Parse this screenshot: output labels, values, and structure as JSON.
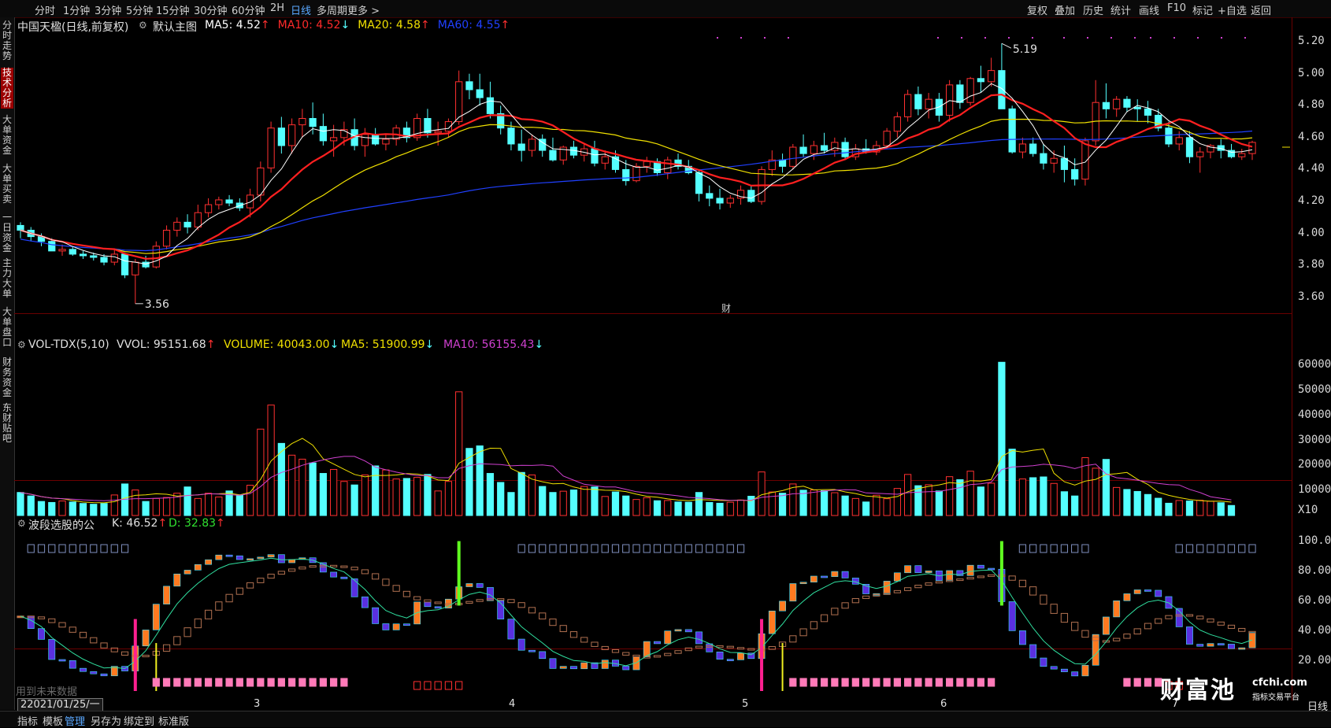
{
  "toolbar": {
    "left_tab": "分时走势",
    "periods": [
      "分时",
      "1分钟",
      "3分钟",
      "5分钟",
      "15分钟",
      "30分钟",
      "60分钟",
      "2H",
      "日线",
      "多周期",
      "更多 >"
    ],
    "active_period": "日线",
    "right_tools": [
      "复权",
      "叠加",
      "历史",
      "统计",
      "画线",
      "F10",
      "标记",
      "+自选",
      "返回"
    ]
  },
  "sidebar": {
    "items": [
      "分时走势",
      "技术分析",
      "大单资金",
      "大单买卖",
      "一日资金",
      "主力大单",
      "大单盘口",
      "财务资金",
      "东财贴吧"
    ],
    "active": "技术分析"
  },
  "main_pane": {
    "stock_name": "中国天楹(日线,前复权)",
    "template_label": "默认主图",
    "ma": [
      {
        "label": "MA5: 4.52",
        "arrow": "↑",
        "color": "#ffffff"
      },
      {
        "label": "MA10: 4.52",
        "arrow": "↓",
        "color": "#ff2a2a"
      },
      {
        "label": "MA20: 4.58",
        "arrow": "↑",
        "color": "#f0e000"
      },
      {
        "label": "MA60: 4.55",
        "arrow": "↑",
        "color": "#2040ff"
      }
    ],
    "high_label": "5.19",
    "low_label": "3.56",
    "event_marker": "财",
    "price_ticks": [
      "5.20",
      "5.00",
      "4.80",
      "4.60",
      "4.40",
      "4.20",
      "4.00",
      "3.80",
      "3.60"
    ],
    "ylim": [
      3.5,
      5.24
    ]
  },
  "volume_pane": {
    "name": "VOL-TDX(5,10)",
    "vvol": "VVOL: 95151.68",
    "vvol_arrow": "↑",
    "volume": "VOLUME: 40043.00",
    "volume_arrow": "↓",
    "ma5": "MA5: 51900.99",
    "ma5_arrow": "↓",
    "ma10": "MA10: 56155.43",
    "ma10_arrow": "↓",
    "ticks": [
      "60000",
      "50000",
      "40000",
      "30000",
      "20000",
      "10000"
    ],
    "unit": "X10"
  },
  "indicator_pane": {
    "name": "波段选股的公",
    "k": "K: 46.52",
    "k_arrow": "↑",
    "d": "D: 32.83",
    "d_arrow": "↑",
    "ticks": [
      "100.0",
      "80.00",
      "60.00",
      "40.00",
      "20.00"
    ],
    "note": "用到未来数据"
  },
  "xaxis": {
    "cursor_date": "2021/01/25/一",
    "cursor_prefix": "2",
    "months": [
      "3",
      "4",
      "5",
      "6",
      "7"
    ],
    "right_label": "日线"
  },
  "watermark": {
    "brand": "财富池",
    "site": "cfchi.com",
    "slogan": "指标交易平台"
  },
  "bottombar": {
    "items": [
      "指标",
      "模板",
      "管理",
      "另存为",
      "绑定到",
      "标准版"
    ],
    "active": "管理"
  },
  "colors": {
    "up": "#ff3030",
    "down": "#54ffff",
    "ma5": "#ffffff",
    "ma10": "#ff2020",
    "ma20": "#f0e000",
    "ma60": "#2040ff",
    "vol_ma5": "#f0e000",
    "vol_ma10": "#d040d0"
  },
  "chart_data": {
    "type": "candlestick",
    "note_units": "price in CNY, volume in lots/10",
    "ohlc": [
      [
        4.05,
        4.07,
        3.97,
        4.02
      ],
      [
        4.02,
        4.04,
        3.95,
        3.98
      ],
      [
        3.98,
        4.0,
        3.92,
        3.95
      ],
      [
        3.95,
        3.97,
        3.9,
        3.89
      ],
      [
        3.89,
        3.93,
        3.86,
        3.9
      ],
      [
        3.9,
        3.92,
        3.86,
        3.87
      ],
      [
        3.87,
        3.89,
        3.84,
        3.86
      ],
      [
        3.86,
        3.88,
        3.83,
        3.85
      ],
      [
        3.85,
        3.87,
        3.8,
        3.82
      ],
      [
        3.82,
        3.9,
        3.8,
        3.87
      ],
      [
        3.87,
        3.88,
        3.72,
        3.74
      ],
      [
        3.74,
        3.84,
        3.56,
        3.82
      ],
      [
        3.82,
        3.86,
        3.78,
        3.79
      ],
      [
        3.79,
        3.95,
        3.78,
        3.92
      ],
      [
        3.92,
        4.05,
        3.9,
        4.02
      ],
      [
        4.02,
        4.1,
        3.98,
        4.07
      ],
      [
        4.07,
        4.12,
        4.0,
        4.04
      ],
      [
        4.04,
        4.18,
        4.02,
        4.13
      ],
      [
        4.13,
        4.22,
        4.1,
        4.18
      ],
      [
        4.18,
        4.23,
        4.15,
        4.21
      ],
      [
        4.21,
        4.24,
        4.17,
        4.19
      ],
      [
        4.19,
        4.22,
        4.14,
        4.16
      ],
      [
        4.16,
        4.28,
        4.1,
        4.24
      ],
      [
        4.24,
        4.45,
        4.2,
        4.41
      ],
      [
        4.41,
        4.7,
        4.38,
        4.66
      ],
      [
        4.66,
        4.73,
        4.5,
        4.55
      ],
      [
        4.55,
        4.72,
        4.5,
        4.68
      ],
      [
        4.68,
        4.78,
        4.6,
        4.72
      ],
      [
        4.72,
        4.82,
        4.62,
        4.67
      ],
      [
        4.67,
        4.75,
        4.55,
        4.58
      ],
      [
        4.58,
        4.68,
        4.48,
        4.6
      ],
      [
        4.6,
        4.7,
        4.55,
        4.65
      ],
      [
        4.65,
        4.72,
        4.52,
        4.55
      ],
      [
        4.55,
        4.66,
        4.48,
        4.62
      ],
      [
        4.62,
        4.66,
        4.55,
        4.56
      ],
      [
        4.56,
        4.62,
        4.52,
        4.59
      ],
      [
        4.59,
        4.68,
        4.55,
        4.66
      ],
      [
        4.66,
        4.7,
        4.57,
        4.6
      ],
      [
        4.6,
        4.75,
        4.58,
        4.72
      ],
      [
        4.72,
        4.78,
        4.6,
        4.63
      ],
      [
        4.63,
        4.7,
        4.55,
        4.64
      ],
      [
        4.64,
        4.72,
        4.6,
        4.7
      ],
      [
        4.7,
        5.02,
        4.68,
        4.95
      ],
      [
        4.95,
        5.0,
        4.84,
        4.9
      ],
      [
        4.9,
        5.0,
        4.8,
        4.85
      ],
      [
        4.85,
        4.95,
        4.72,
        4.75
      ],
      [
        4.75,
        4.8,
        4.62,
        4.66
      ],
      [
        4.66,
        4.7,
        4.52,
        4.56
      ],
      [
        4.56,
        4.65,
        4.45,
        4.52
      ],
      [
        4.52,
        4.62,
        4.48,
        4.59
      ],
      [
        4.59,
        4.62,
        4.48,
        4.52
      ],
      [
        4.52,
        4.6,
        4.45,
        4.46
      ],
      [
        4.46,
        4.55,
        4.43,
        4.54
      ],
      [
        4.54,
        4.58,
        4.47,
        4.49
      ],
      [
        4.49,
        4.56,
        4.45,
        4.53
      ],
      [
        4.53,
        4.58,
        4.42,
        4.44
      ],
      [
        4.44,
        4.52,
        4.4,
        4.48
      ],
      [
        4.48,
        4.52,
        4.38,
        4.4
      ],
      [
        4.4,
        4.46,
        4.3,
        4.33
      ],
      [
        4.33,
        4.44,
        4.32,
        4.42
      ],
      [
        4.42,
        4.48,
        4.38,
        4.45
      ],
      [
        4.45,
        4.47,
        4.36,
        4.38
      ],
      [
        4.38,
        4.48,
        4.34,
        4.46
      ],
      [
        4.46,
        4.5,
        4.4,
        4.42
      ],
      [
        4.42,
        4.46,
        4.37,
        4.38
      ],
      [
        4.38,
        4.4,
        4.2,
        4.25
      ],
      [
        4.25,
        4.3,
        4.17,
        4.22
      ],
      [
        4.22,
        4.28,
        4.15,
        4.19
      ],
      [
        4.19,
        4.24,
        4.16,
        4.22
      ],
      [
        4.22,
        4.3,
        4.18,
        4.27
      ],
      [
        4.27,
        4.3,
        4.19,
        4.2
      ],
      [
        4.2,
        4.42,
        4.18,
        4.4
      ],
      [
        4.4,
        4.52,
        4.36,
        4.46
      ],
      [
        4.46,
        4.5,
        4.38,
        4.42
      ],
      [
        4.42,
        4.56,
        4.4,
        4.54
      ],
      [
        4.54,
        4.62,
        4.48,
        4.5
      ],
      [
        4.5,
        4.58,
        4.46,
        4.55
      ],
      [
        4.55,
        4.63,
        4.5,
        4.52
      ],
      [
        4.52,
        4.6,
        4.48,
        4.57
      ],
      [
        4.57,
        4.6,
        4.46,
        4.48
      ],
      [
        4.48,
        4.56,
        4.46,
        4.53
      ],
      [
        4.53,
        4.59,
        4.5,
        4.51
      ],
      [
        4.51,
        4.58,
        4.49,
        4.55
      ],
      [
        4.55,
        4.66,
        4.53,
        4.64
      ],
      [
        4.64,
        4.76,
        4.6,
        4.73
      ],
      [
        4.73,
        4.9,
        4.7,
        4.87
      ],
      [
        4.87,
        4.92,
        4.74,
        4.78
      ],
      [
        4.78,
        4.88,
        4.72,
        4.84
      ],
      [
        4.84,
        4.88,
        4.7,
        4.74
      ],
      [
        4.74,
        4.96,
        4.7,
        4.93
      ],
      [
        4.93,
        4.96,
        4.78,
        4.82
      ],
      [
        4.82,
        4.98,
        4.8,
        4.97
      ],
      [
        4.97,
        5.05,
        4.88,
        4.95
      ],
      [
        4.95,
        5.1,
        4.92,
        5.02
      ],
      [
        5.02,
        5.19,
        4.96,
        4.78
      ],
      [
        4.78,
        4.8,
        4.5,
        4.51
      ],
      [
        4.51,
        4.6,
        4.47,
        4.56
      ],
      [
        4.56,
        4.6,
        4.48,
        4.5
      ],
      [
        4.5,
        4.56,
        4.4,
        4.44
      ],
      [
        4.44,
        4.52,
        4.38,
        4.47
      ],
      [
        4.47,
        4.55,
        4.32,
        4.4
      ],
      [
        4.4,
        4.47,
        4.3,
        4.34
      ],
      [
        4.34,
        4.6,
        4.3,
        4.58
      ],
      [
        4.58,
        4.96,
        4.55,
        4.82
      ],
      [
        4.82,
        4.94,
        4.72,
        4.78
      ],
      [
        4.78,
        4.86,
        4.73,
        4.84
      ],
      [
        4.84,
        4.86,
        4.76,
        4.79
      ],
      [
        4.79,
        4.84,
        4.7,
        4.78
      ],
      [
        4.78,
        4.83,
        4.69,
        4.74
      ],
      [
        4.74,
        4.78,
        4.64,
        4.66
      ],
      [
        4.66,
        4.7,
        4.54,
        4.56
      ],
      [
        4.56,
        4.64,
        4.52,
        4.6
      ],
      [
        4.6,
        4.64,
        4.44,
        4.48
      ],
      [
        4.48,
        4.54,
        4.38,
        4.51
      ],
      [
        4.51,
        4.56,
        4.47,
        4.55
      ],
      [
        4.55,
        4.59,
        4.47,
        4.52
      ],
      [
        4.52,
        4.56,
        4.47,
        4.48
      ],
      [
        4.48,
        4.53,
        4.46,
        4.5
      ],
      [
        4.5,
        4.58,
        4.46,
        4.57
      ]
    ],
    "volume": [
      9200,
      7800,
      5600,
      5200,
      5800,
      5400,
      4800,
      4500,
      4800,
      8200,
      12600,
      10200,
      5600,
      6800,
      7200,
      8900,
      11400,
      6800,
      8900,
      7400,
      9800,
      8200,
      12100,
      34500,
      44100,
      28800,
      24100,
      22500,
      21000,
      16800,
      18400,
      13600,
      12200,
      16200,
      19800,
      18200,
      14600,
      14800,
      15200,
      16400,
      9800,
      13600,
      49400,
      26800,
      27800,
      16800,
      13200,
      9200,
      17200,
      16200,
      11600,
      9200,
      9700,
      10200,
      11600,
      11400,
      7600,
      9400,
      7800,
      6400,
      7100,
      5900,
      6000,
      5400,
      5300,
      9200,
      5200,
      4900,
      5300,
      6200,
      7700,
      17400,
      9400,
      8900,
      12600,
      10100,
      10200,
      9900,
      9100,
      7800,
      6800,
      5400,
      8100,
      6700,
      10800,
      16400,
      11900,
      12300,
      9800,
      15500,
      14300,
      17700,
      11400,
      12900,
      61200,
      26500,
      14600,
      15100,
      15400,
      12800,
      9500,
      7800,
      23100,
      18900,
      22400,
      11200,
      10400,
      9600,
      8400,
      6900,
      4900,
      6000,
      5800,
      6100,
      5700,
      5100,
      4000
    ]
  }
}
